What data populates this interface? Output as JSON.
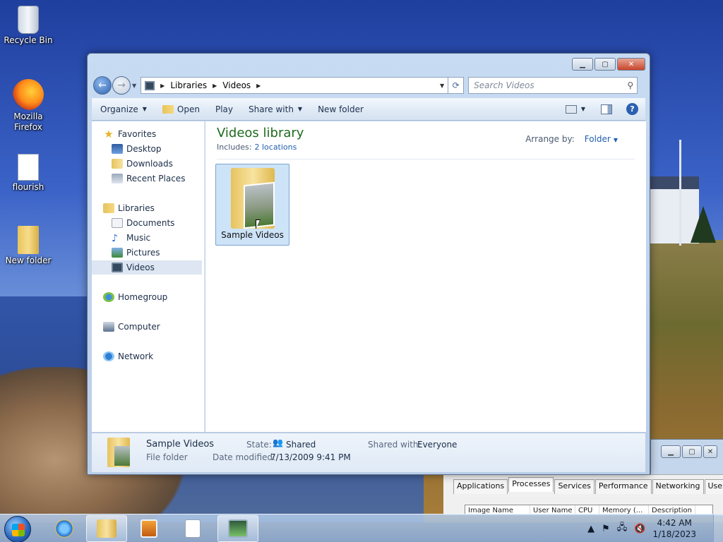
{
  "desktop": {
    "icons": [
      {
        "label": "Recycle Bin",
        "icon": "recycle-bin-icon"
      },
      {
        "label": "Mozilla Firefox",
        "icon": "firefox-icon"
      },
      {
        "label": "flourish",
        "icon": "media-file-icon"
      },
      {
        "label": "New folder",
        "icon": "folder-icon"
      }
    ]
  },
  "explorer": {
    "address": {
      "segments": [
        "Libraries",
        "Videos"
      ]
    },
    "search": {
      "placeholder": "Search Videos"
    },
    "commands": {
      "organize": "Organize",
      "open": "Open",
      "play": "Play",
      "share_with": "Share with",
      "new_folder": "New folder"
    },
    "nav": {
      "favorites": {
        "label": "Favorites",
        "items": [
          "Desktop",
          "Downloads",
          "Recent Places"
        ]
      },
      "libraries": {
        "label": "Libraries",
        "items": [
          "Documents",
          "Music",
          "Pictures",
          "Videos"
        ],
        "selected": "Videos"
      },
      "homegroup": "Homegroup",
      "computer": "Computer",
      "network": "Network"
    },
    "content": {
      "title": "Videos library",
      "includes_label": "Includes:",
      "includes_link": "2 locations",
      "arrange_label": "Arrange by:",
      "arrange_value": "Folder",
      "items": [
        {
          "name": "Sample Videos",
          "selected": true
        }
      ]
    },
    "details": {
      "name": "Sample Videos",
      "type": "File folder",
      "state_label": "State:",
      "state_value": "Shared",
      "date_label": "Date modified:",
      "date_value": "7/13/2009 9:41 PM",
      "shared_label": "Shared with:",
      "shared_value": "Everyone"
    }
  },
  "task_manager": {
    "tabs": [
      "Applications",
      "Processes",
      "Services",
      "Performance",
      "Networking",
      "Users"
    ],
    "active_tab": "Processes",
    "columns": [
      "Image Name",
      "User Name",
      "CPU",
      "Memory (...",
      "Description"
    ]
  },
  "taskbar": {
    "clock": {
      "time": "4:42 AM",
      "date": "1/18/2023"
    },
    "buttons": [
      "internet-explorer-icon",
      "windows-explorer-icon",
      "media-player-icon",
      "document-icon",
      "task-manager-icon"
    ]
  },
  "colors": {
    "accent": "#1f5fb0",
    "library_title": "#1d6b1d",
    "selection": "#cde3f7"
  }
}
